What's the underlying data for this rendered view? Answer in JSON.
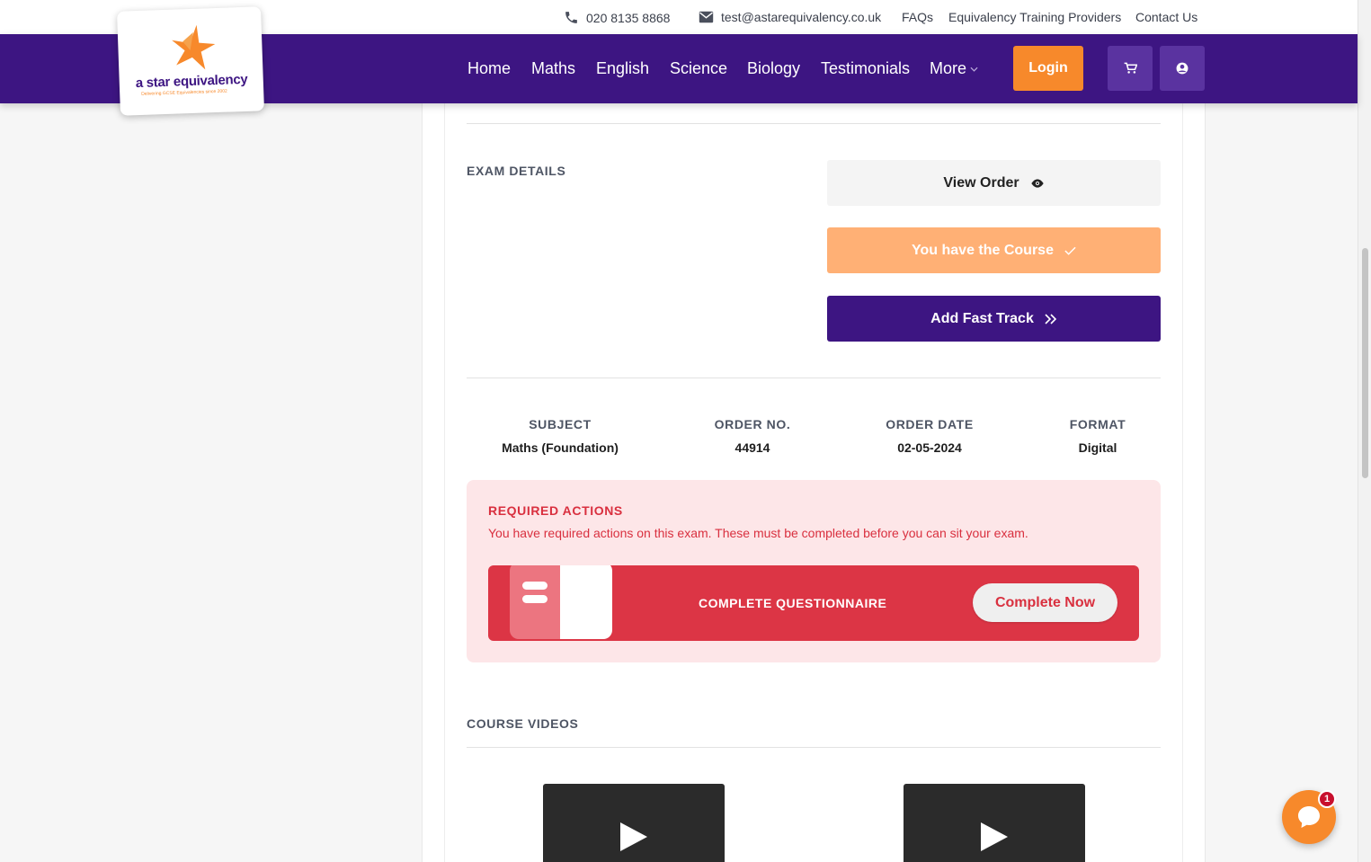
{
  "topbar": {
    "phone": "020 8135 8868",
    "email": "test@astarequivalency.co.uk",
    "links": [
      "FAQs",
      "Equivalency Training Providers",
      "Contact Us"
    ]
  },
  "logo": {
    "name": "a star equivalency",
    "tagline": "Delivering GCSE Equivalencies since 2002"
  },
  "nav": {
    "items": [
      "Home",
      "Maths",
      "English",
      "Science",
      "Biology",
      "Testimonials"
    ],
    "more": "More",
    "login": "Login"
  },
  "exam": {
    "section_label": "EXAM DETAILS",
    "view_order": "View Order",
    "have_course": "You have the Course",
    "fast_track": "Add Fast Track"
  },
  "details": [
    {
      "label": "SUBJECT",
      "value": "Maths (Foundation)"
    },
    {
      "label": "ORDER NO.",
      "value": "44914"
    },
    {
      "label": "ORDER DATE",
      "value": "02-05-2024"
    },
    {
      "label": "FORMAT",
      "value": "Digital"
    }
  ],
  "required": {
    "title": "REQUIRED ACTIONS",
    "description": "You have required actions on this exam. These must be completed before you can sit your exam.",
    "task": "COMPLETE QUESTIONNAIRE",
    "button": "Complete Now"
  },
  "videos": {
    "section_label": "COURSE VIDEOS"
  },
  "chat": {
    "badge": "1"
  },
  "colors": {
    "brand_purple": "#3d1582",
    "brand_orange": "#f7892b",
    "alert_red": "#dc3545",
    "alert_bg": "#fde6e8"
  }
}
